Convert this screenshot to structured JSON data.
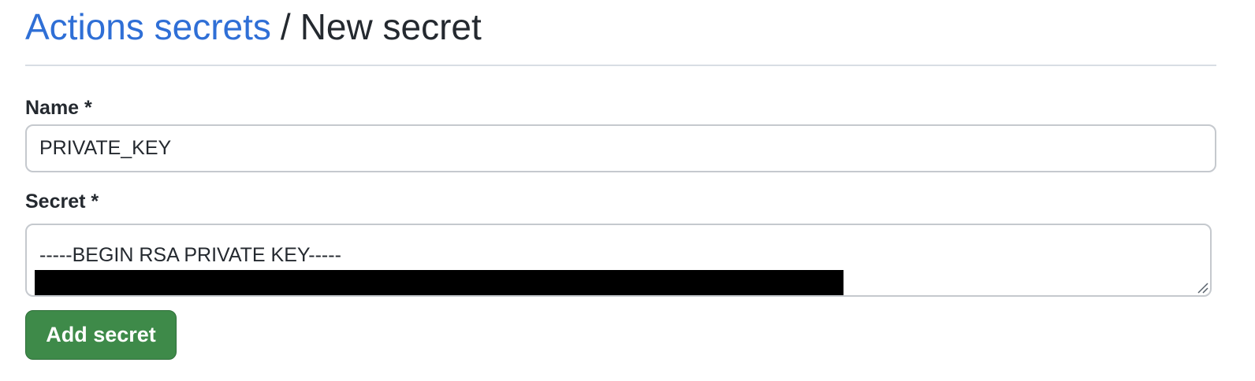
{
  "breadcrumb": {
    "parent_label": "Actions secrets",
    "separator": "/",
    "current_label": "New secret"
  },
  "form": {
    "name_label": "Name *",
    "name_value": "PRIVATE_KEY",
    "secret_label": "Secret *",
    "secret_first_line": "-----BEGIN RSA PRIVATE KEY-----",
    "submit_label": "Add secret"
  },
  "colors": {
    "link": "#2f6fd6",
    "primary_button": "#3e8a49",
    "text": "#24292f",
    "border": "#c5c9ce",
    "redaction": "#000000"
  },
  "icons": {
    "textarea_resize": "resize-grip-icon"
  }
}
